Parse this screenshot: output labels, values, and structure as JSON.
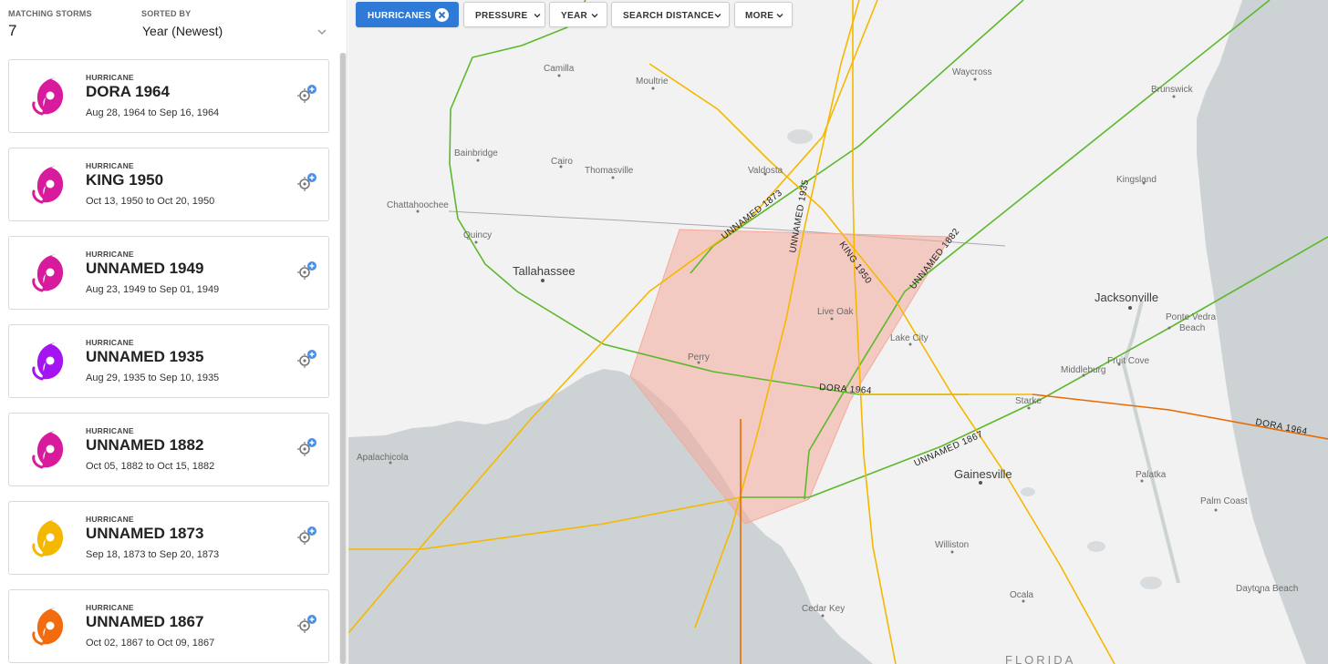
{
  "header": {
    "matching_label": "MATCHING STORMS",
    "matching_count": "7",
    "sorted_label": "SORTED BY",
    "sorted_value": "Year (Newest)"
  },
  "storms": [
    {
      "category": "HURRICANE",
      "name": "DORA 1964",
      "dates": "Aug 28, 1964 to Sep 16, 1964",
      "color": "#d81b9c"
    },
    {
      "category": "HURRICANE",
      "name": "KING 1950",
      "dates": "Oct 13, 1950 to Oct 20, 1950",
      "color": "#d81b9c"
    },
    {
      "category": "HURRICANE",
      "name": "UNNAMED 1949",
      "dates": "Aug 23, 1949 to Sep 01, 1949",
      "color": "#d81b9c"
    },
    {
      "category": "HURRICANE",
      "name": "UNNAMED 1935",
      "dates": "Aug 29, 1935 to Sep 10, 1935",
      "color": "#a314f0"
    },
    {
      "category": "HURRICANE",
      "name": "UNNAMED 1882",
      "dates": "Oct 05, 1882 to Oct 15, 1882",
      "color": "#d81b9c"
    },
    {
      "category": "HURRICANE",
      "name": "UNNAMED 1873",
      "dates": "Sep 18, 1873 to Sep 20, 1873",
      "color": "#f5b800"
    },
    {
      "category": "HURRICANE",
      "name": "UNNAMED 1867",
      "dates": "Oct 02, 1867 to Oct 09, 1867",
      "color": "#f26b0f"
    }
  ],
  "filters": {
    "hurricanes": "HURRICANES",
    "pressure": "PRESSURE",
    "year": "YEAR",
    "distance": "SEARCH DISTANCE",
    "more": "MORE"
  },
  "map": {
    "places": {
      "camilla": "Camilla",
      "moultrie": "Moultrie",
      "waycross": "Waycross",
      "brunswick": "Brunswick",
      "bainbridge": "Bainbridge",
      "cairo": "Cairo",
      "thomasville": "Thomasville",
      "valdosta": "Valdosta",
      "kingsland": "Kingsland",
      "chattahoochee": "Chattahoochee",
      "quincy": "Quincy",
      "tallahassee": "Tallahassee",
      "live_oak": "Live Oak",
      "jacksonville": "Jacksonville",
      "ponte_vedra": "Ponte Vedra",
      "beach": "Beach",
      "lake_city": "Lake City",
      "perry": "Perry",
      "middleburg": "Middleburg",
      "fruit_cove": "Fruit Cove",
      "starke": "Starke",
      "apalachicola": "Apalachicola",
      "gainesville": "Gainesville",
      "palatka": "Palatka",
      "palm_coast": "Palm Coast",
      "williston": "Williston",
      "ocala": "Ocala",
      "daytona_beach": "Daytona Beach",
      "cedar_key": "Cedar Key",
      "florida": "FLORIDA"
    },
    "track_labels": {
      "dora_a": "DORA 1964",
      "dora_b": "DORA 1964",
      "u1873": "UNNAMED 1873",
      "u1935": "UNNAMED 1935",
      "king": "KING 1950",
      "u1882": "UNNAMED 1882",
      "u1867": "UNNAMED 1867"
    },
    "colors": {
      "land": "#f2f2f2",
      "water": "#cdd2d4",
      "green_track": "#5cb82c",
      "yellow_track": "#f5b800",
      "orange_track": "#e86a00",
      "search_area": "#f4a99a"
    }
  }
}
